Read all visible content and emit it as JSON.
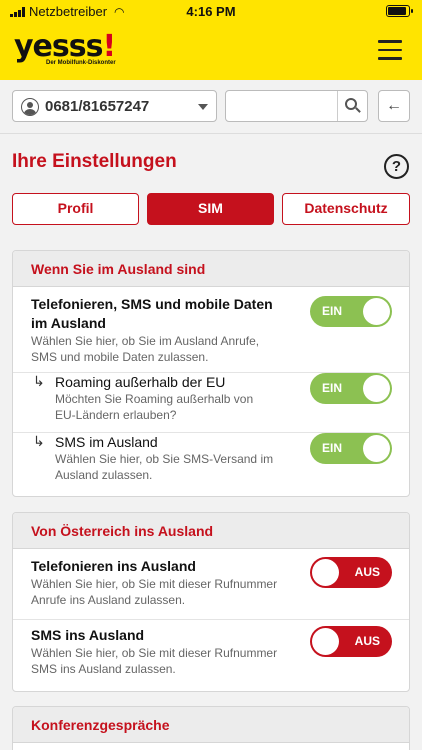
{
  "status_bar": {
    "carrier": "Netzbetreiber",
    "time": "4:16 PM"
  },
  "header": {
    "logo_text": "yesss",
    "logo_bang": "!",
    "logo_tagline": "Der Mobilfunk-Diskonter",
    "menu_icon": "hamburger-icon"
  },
  "search_bar": {
    "phone_number": "0681/81657247",
    "search_value": "",
    "search_placeholder": "",
    "back_symbol": "←"
  },
  "page": {
    "title": "Ihre Einstellungen",
    "help_symbol": "?"
  },
  "tabs": [
    {
      "label": "Profil",
      "active": false
    },
    {
      "label": "SIM",
      "active": true
    },
    {
      "label": "Datenschutz",
      "active": false
    }
  ],
  "sections": [
    {
      "heading": "Wenn Sie im Ausland sind",
      "rows": [
        {
          "title": "Telefonieren, SMS und mobile Daten im Ausland",
          "description": "Wählen Sie hier, ob Sie im Ausland Anrufe, SMS und mobile Daten zulassen.",
          "toggle": "EIN"
        },
        {
          "title": "Roaming außerhalb der EU",
          "description": "Möchten Sie Roaming außerhalb von EU-Ländern erlauben?",
          "toggle": "EIN"
        },
        {
          "title": "SMS im Ausland",
          "description": "Wählen Sie hier, ob Sie SMS-Versand im Ausland zulassen.",
          "toggle": "EIN"
        }
      ]
    },
    {
      "heading": "Von Österreich ins Ausland",
      "rows": [
        {
          "title": "Telefonieren ins Ausland",
          "description": "Wählen Sie hier, ob Sie mit dieser Rufnummer Anrufe ins Ausland zulassen.",
          "toggle": "AUS"
        },
        {
          "title": "SMS ins Ausland",
          "description": "Wählen Sie hier, ob Sie mit dieser Rufnummer SMS ins Ausland zulassen.",
          "toggle": "AUS"
        }
      ]
    },
    {
      "heading": "Konferenzgespräche"
    }
  ],
  "colors": {
    "brand_yellow": "#ffe400",
    "brand_red": "#c5111d",
    "toggle_on": "#8cc152",
    "background": "#f2f2f2"
  }
}
